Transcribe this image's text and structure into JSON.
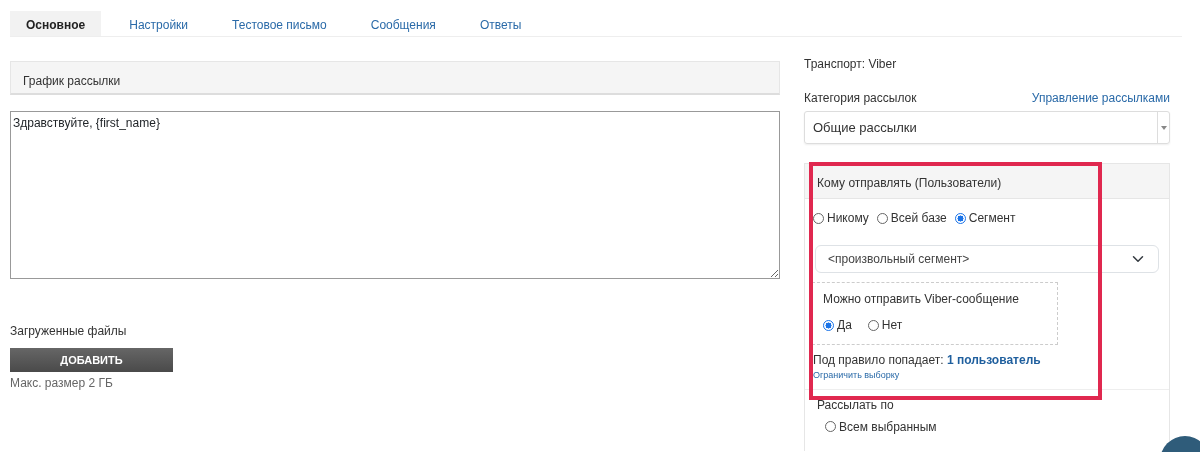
{
  "tabs": [
    {
      "label": "Основное",
      "selected": true
    },
    {
      "label": "Настройки",
      "selected": false
    },
    {
      "label": "Тестовое письмо",
      "selected": false
    },
    {
      "label": "Сообщения",
      "selected": false
    },
    {
      "label": "Ответы",
      "selected": false
    }
  ],
  "schedule_panel": {
    "title": "График рассылки"
  },
  "message": {
    "value": "Здравствуйте, {first_name}"
  },
  "files": {
    "label": "Загруженные файлы",
    "button": "ДОБАВИТЬ",
    "hint": "Макс. размер 2 ГБ"
  },
  "transport": "Транспорт: Viber",
  "category": {
    "label": "Категория рассылок",
    "link": "Управление рассылками",
    "value": "Общие рассылки"
  },
  "recipients": {
    "title": "Кому отправлять (Пользователи)",
    "highlighted": true,
    "options": [
      {
        "label": "Никому",
        "selected": false
      },
      {
        "label": "Всей базе",
        "selected": false
      },
      {
        "label": "Сегмент",
        "selected": true
      }
    ],
    "segment": "<произвольный сегмент>",
    "condition": {
      "label": "Можно отправить Viber-сообщение",
      "options": [
        {
          "label": "Да",
          "selected": true
        },
        {
          "label": "Нет",
          "selected": false
        }
      ]
    },
    "rule_text": "Под правило попадает: **1 пользователь**",
    "limit_link": "Ограничить выборку"
  },
  "send_by": {
    "label": "Рассылать по",
    "options": [
      {
        "label": "Всем выбранным",
        "selected": false
      }
    ]
  }
}
